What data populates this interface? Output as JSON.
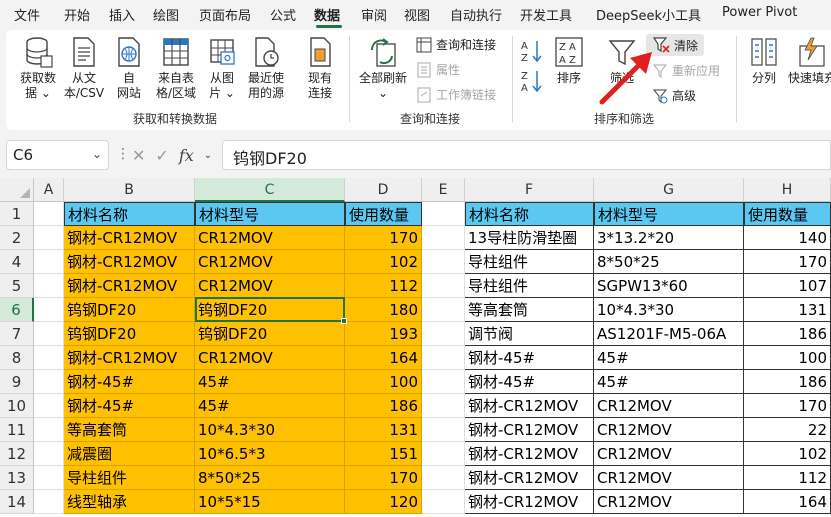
{
  "menu": [
    "文件",
    "开始",
    "插入",
    "绘图",
    "页面布局",
    "公式",
    "数据",
    "审阅",
    "视图",
    "自动执行",
    "开发工具",
    "DeepSeek小工具",
    "Power Pivot"
  ],
  "menu_active": "数据",
  "ribbon": {
    "get_data": {
      "line1": "获取数",
      "line2": "据 ⌄"
    },
    "from_text": {
      "line1": "从文",
      "line2": "本/CSV"
    },
    "from_web": {
      "line1": "自",
      "line2": "网站"
    },
    "from_table": {
      "line1": "来自表",
      "line2": "格/区域"
    },
    "from_picture": {
      "line1": "从图",
      "line2": "片 ⌄"
    },
    "recent_sources": {
      "line1": "最近使",
      "line2": "用的源"
    },
    "existing": {
      "line1": "现有",
      "line2": "连接"
    },
    "group_get": "获取和转换数据",
    "refresh_all": {
      "line1": "全部刷新",
      "line2": "⌄"
    },
    "queries": "查询和连接",
    "properties": "属性",
    "workbook_links": "工作簿链接",
    "group_queries": "查询和连接",
    "sort": "排序",
    "filter": "筛选",
    "clear": "清除",
    "reapply": "重新应用",
    "advanced": "高级",
    "group_sort": "排序和筛选",
    "split": "分列",
    "flash_fill": "快速填充"
  },
  "formula_bar": {
    "name_box": "C6",
    "fx": "fx",
    "formula": "钨钢DF20"
  },
  "columns": [
    "A",
    "B",
    "C",
    "D",
    "E",
    "F",
    "G",
    "H"
  ],
  "selected_column": "C",
  "rows": [
    "1",
    "2",
    "4",
    "5",
    "6",
    "7",
    "8",
    "9",
    "10",
    "11",
    "12",
    "13",
    "14"
  ],
  "selected_row": "6",
  "table1": {
    "headers": [
      "材料名称",
      "材料型号",
      "使用数量"
    ],
    "rows": [
      [
        "钢材-CR12MOV",
        "CR12MOV",
        "170"
      ],
      [
        "钢材-CR12MOV",
        "CR12MOV",
        "102"
      ],
      [
        "钢材-CR12MOV",
        "CR12MOV",
        "112"
      ],
      [
        "钨钢DF20",
        "钨钢DF20",
        "180"
      ],
      [
        "钨钢DF20",
        "钨钢DF20",
        "193"
      ],
      [
        "钢材-CR12MOV",
        "CR12MOV",
        "164"
      ],
      [
        "钢材-45#",
        "45#",
        "100"
      ],
      [
        "钢材-45#",
        "45#",
        "186"
      ],
      [
        "等高套筒",
        "10*4.3*30",
        "131"
      ],
      [
        "减震圈",
        "10*6.5*3",
        "151"
      ],
      [
        "导柱组件",
        "8*50*25",
        "170"
      ],
      [
        "线型轴承",
        "10*5*15",
        "120"
      ]
    ]
  },
  "table2": {
    "headers": [
      "材料名称",
      "材料型号",
      "使用数量"
    ],
    "rows": [
      [
        "13导柱防滑垫圈",
        "3*13.2*20",
        "140"
      ],
      [
        "导柱组件",
        "8*50*25",
        "170"
      ],
      [
        "导柱组件",
        "SGPW13*60",
        "107"
      ],
      [
        "等高套筒",
        "10*4.3*30",
        "131"
      ],
      [
        "调节阀",
        "AS1201F-M5-06A",
        "186"
      ],
      [
        "钢材-45#",
        "45#",
        "100"
      ],
      [
        "钢材-45#",
        "45#",
        "186"
      ],
      [
        "钢材-CR12MOV",
        "CR12MOV",
        "170"
      ],
      [
        "钢材-CR12MOV",
        "CR12MOV",
        "22"
      ],
      [
        "钢材-CR12MOV",
        "CR12MOV",
        "102"
      ],
      [
        "钢材-CR12MOV",
        "CR12MOV",
        "112"
      ],
      [
        "钢材-CR12MOV",
        "CR12MOV",
        "164"
      ]
    ]
  },
  "colors": {
    "accent": "#217346",
    "orange": "#ffc000",
    "header_blue": "#5ac8f0",
    "arrow": "#e0201e"
  }
}
